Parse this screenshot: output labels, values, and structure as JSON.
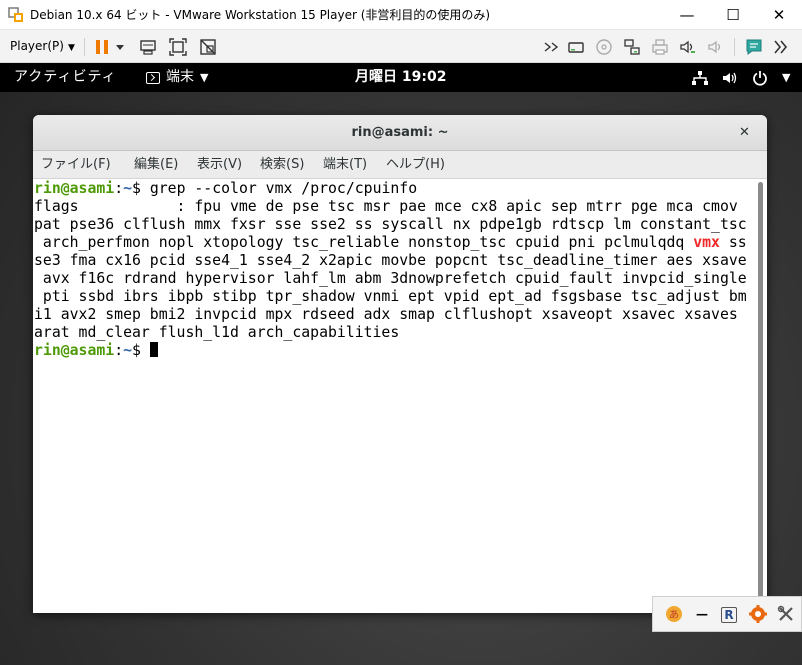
{
  "window": {
    "title": "Debian 10.x 64 ビット - VMware Workstation 15 Player (非営利目的の使用のみ)",
    "minimize_symbol": "—",
    "maximize_symbol": "☐",
    "close_symbol": "✕"
  },
  "vm_toolbar": {
    "player_label": "Player(P)",
    "player_caret": "▼",
    "icons_left": [
      "pause-icon",
      "pause-dropdown-icon",
      "send-ctrl-alt-del-icon",
      "fullscreen-icon",
      "unity-icon"
    ],
    "icons_right": [
      "expand-icon",
      "hard-disk-icon",
      "cd-icon",
      "network-icon",
      "printer-icon",
      "sound-icon",
      "audio-icon",
      "message-icon",
      "vmware-help-icon"
    ]
  },
  "gnome_bar": {
    "activities": "アクティビティ",
    "app_name": "端末",
    "app_caret": "▼",
    "clock": "月曜日 19:02",
    "tray_caret": "▼"
  },
  "terminal": {
    "title": "rin@asami: ~",
    "close_symbol": "✕",
    "menus": [
      "ファイル(F)",
      "編集(E)",
      "表示(V)",
      "検索(S)",
      "端末(T)",
      "ヘルプ(H)"
    ],
    "prompt_user": "rin@asami",
    "prompt_colon": ":",
    "prompt_path": "~",
    "prompt_symbol": "$ ",
    "command": "grep --color vmx /proc/cpuinfo",
    "output_lines": [
      "flags           : fpu vme de pse tsc msr pae mce cx8 apic sep mtrr pge mca cmov",
      "pat pse36 clflush mmx fxsr sse sse2 ss syscall nx pdpe1gb rdtscp lm constant_tsc",
      " arch_perfmon nopl xtopology tsc_reliable nonstop_tsc cpuid pni pclmulqdq ",
      "se3 fma cx16 pcid sse4_1 sse4_2 x2apic movbe popcnt tsc_deadline_timer aes xsave",
      " avx f16c rdrand hypervisor lahf_lm abm 3dnowprefetch cpuid_fault invpcid_single",
      " pti ssbd ibrs ibpb stibp tpr_shadow vnmi ept vpid ept_ad fsgsbase tsc_adjust bm",
      "i1 avx2 smep bmi2 invpcid mpx rdseed adx smap clflushopt xsaveopt xsavec xsaves",
      "arat md_clear flush_l1d arch_capabilities"
    ],
    "highlight": "vmx",
    "line3_suffix": " ss"
  },
  "ime_bar": {
    "items": [
      "ime-mode-icon",
      "ime-dash-icon",
      "ime-r-icon",
      "ime-gear-icon",
      "ime-tools-icon"
    ],
    "r_label": "R",
    "dash_label": "—"
  },
  "colors": {
    "prompt_user": "#4e9a06",
    "prompt_path": "#3465a4",
    "grep_match": "#ef2929",
    "pause_orange": "#f07a00",
    "gnome_bar": "#000000"
  }
}
